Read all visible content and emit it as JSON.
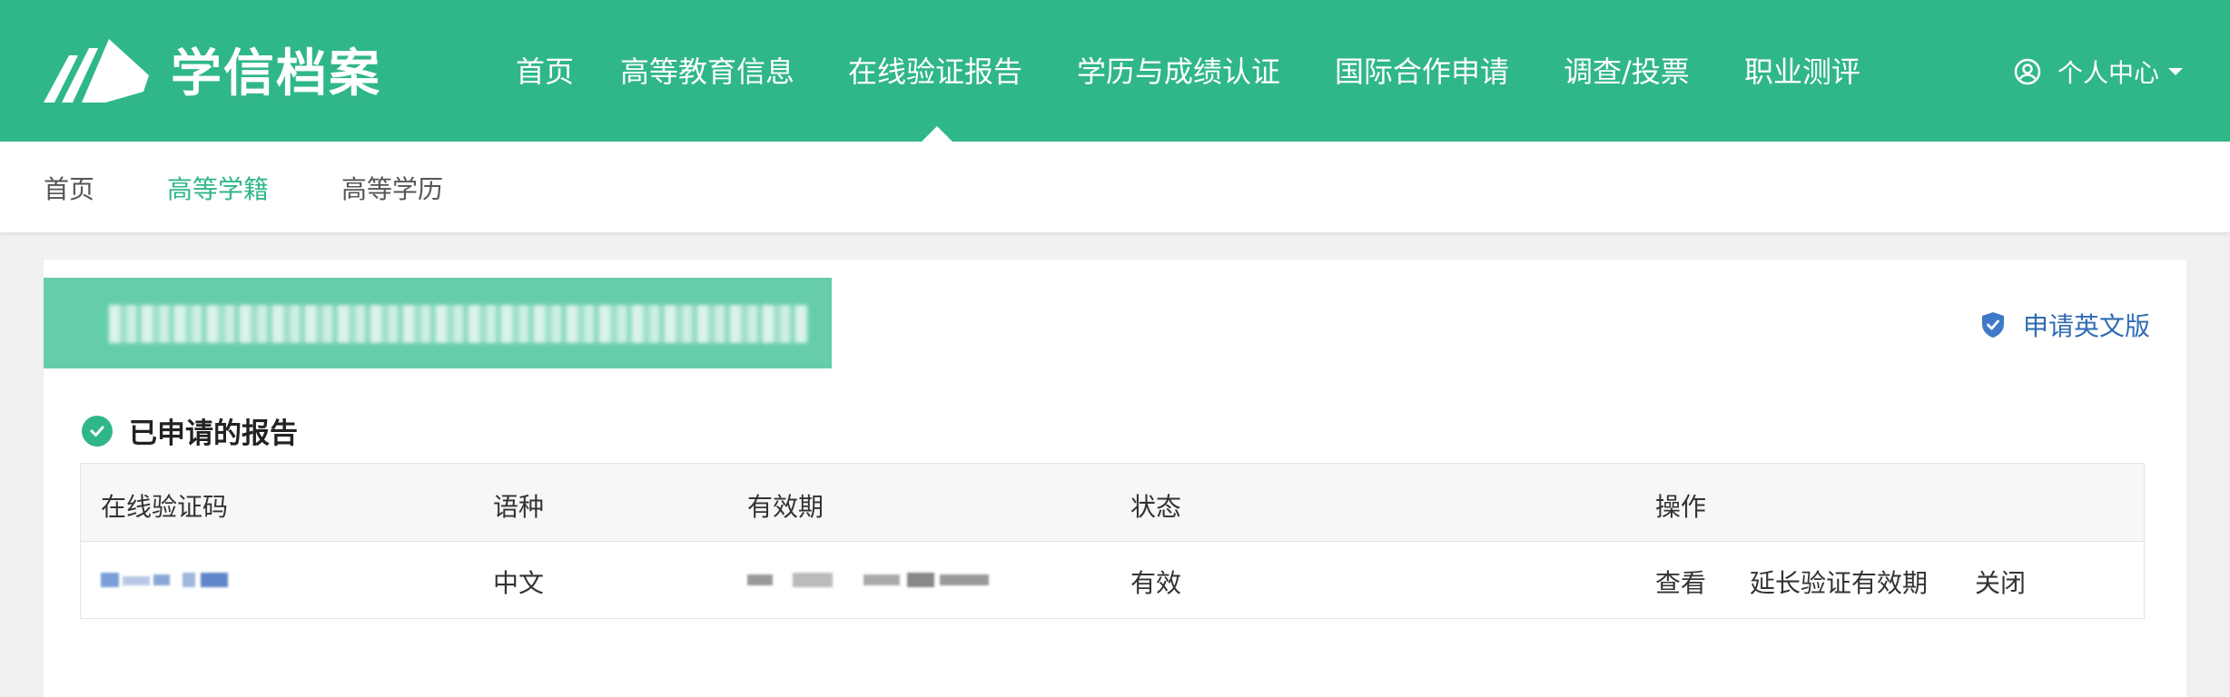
{
  "app": {
    "logo_text": "学信档案"
  },
  "nav": {
    "items": [
      "首页",
      "高等教育信息",
      "在线验证报告",
      "学历与成绩认证",
      "国际合作申请",
      "调查/投票",
      "职业测评"
    ],
    "active": "在线验证报告"
  },
  "user": {
    "label": "个人中心"
  },
  "subnav": {
    "items": [
      "首页",
      "高等学籍",
      "高等学历"
    ],
    "active": "高等学籍"
  },
  "actions": {
    "apply_english": "申请英文版"
  },
  "section": {
    "title": "已申请的报告"
  },
  "table": {
    "headers": [
      "在线验证码",
      "语种",
      "有效期",
      "状态",
      "操作"
    ],
    "rows": [
      {
        "language": "中文",
        "status": "有效",
        "actions": [
          "查看",
          "延长验证有效期",
          "关闭"
        ]
      }
    ]
  },
  "colors": {
    "brand": "#30b787",
    "link": "#2f6bb3",
    "banner": "#66cdaa"
  }
}
